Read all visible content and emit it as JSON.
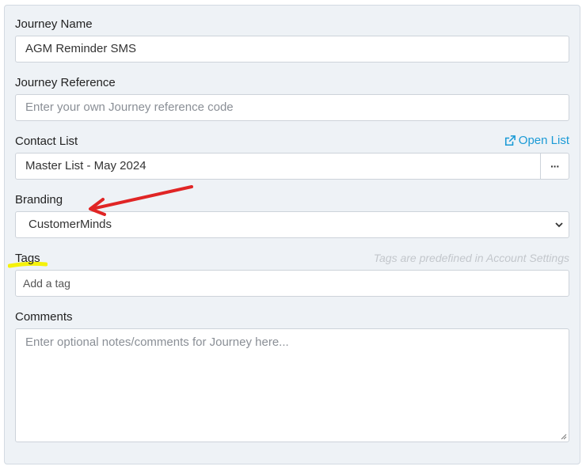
{
  "form": {
    "journey_name": {
      "label": "Journey Name",
      "value": "AGM Reminder SMS"
    },
    "journey_reference": {
      "label": "Journey Reference",
      "placeholder": "Enter your own Journey reference code"
    },
    "contact_list": {
      "label": "Contact List",
      "value": "Master List - May 2024",
      "open_list_label": "Open List",
      "more_button_label": "···"
    },
    "branding": {
      "label": "Branding",
      "value": "CustomerMinds"
    },
    "tags": {
      "label": "Tags",
      "hint": "Tags are predefined in Account Settings",
      "placeholder": "Add a tag"
    },
    "comments": {
      "label": "Comments",
      "placeholder": "Enter optional notes/comments for Journey here..."
    }
  },
  "annotations": {
    "arrow_color": "#e02525",
    "highlight_color": "#f5f20a"
  },
  "colors": {
    "link": "#1a9ad6",
    "panel_bg": "#eef2f6"
  }
}
